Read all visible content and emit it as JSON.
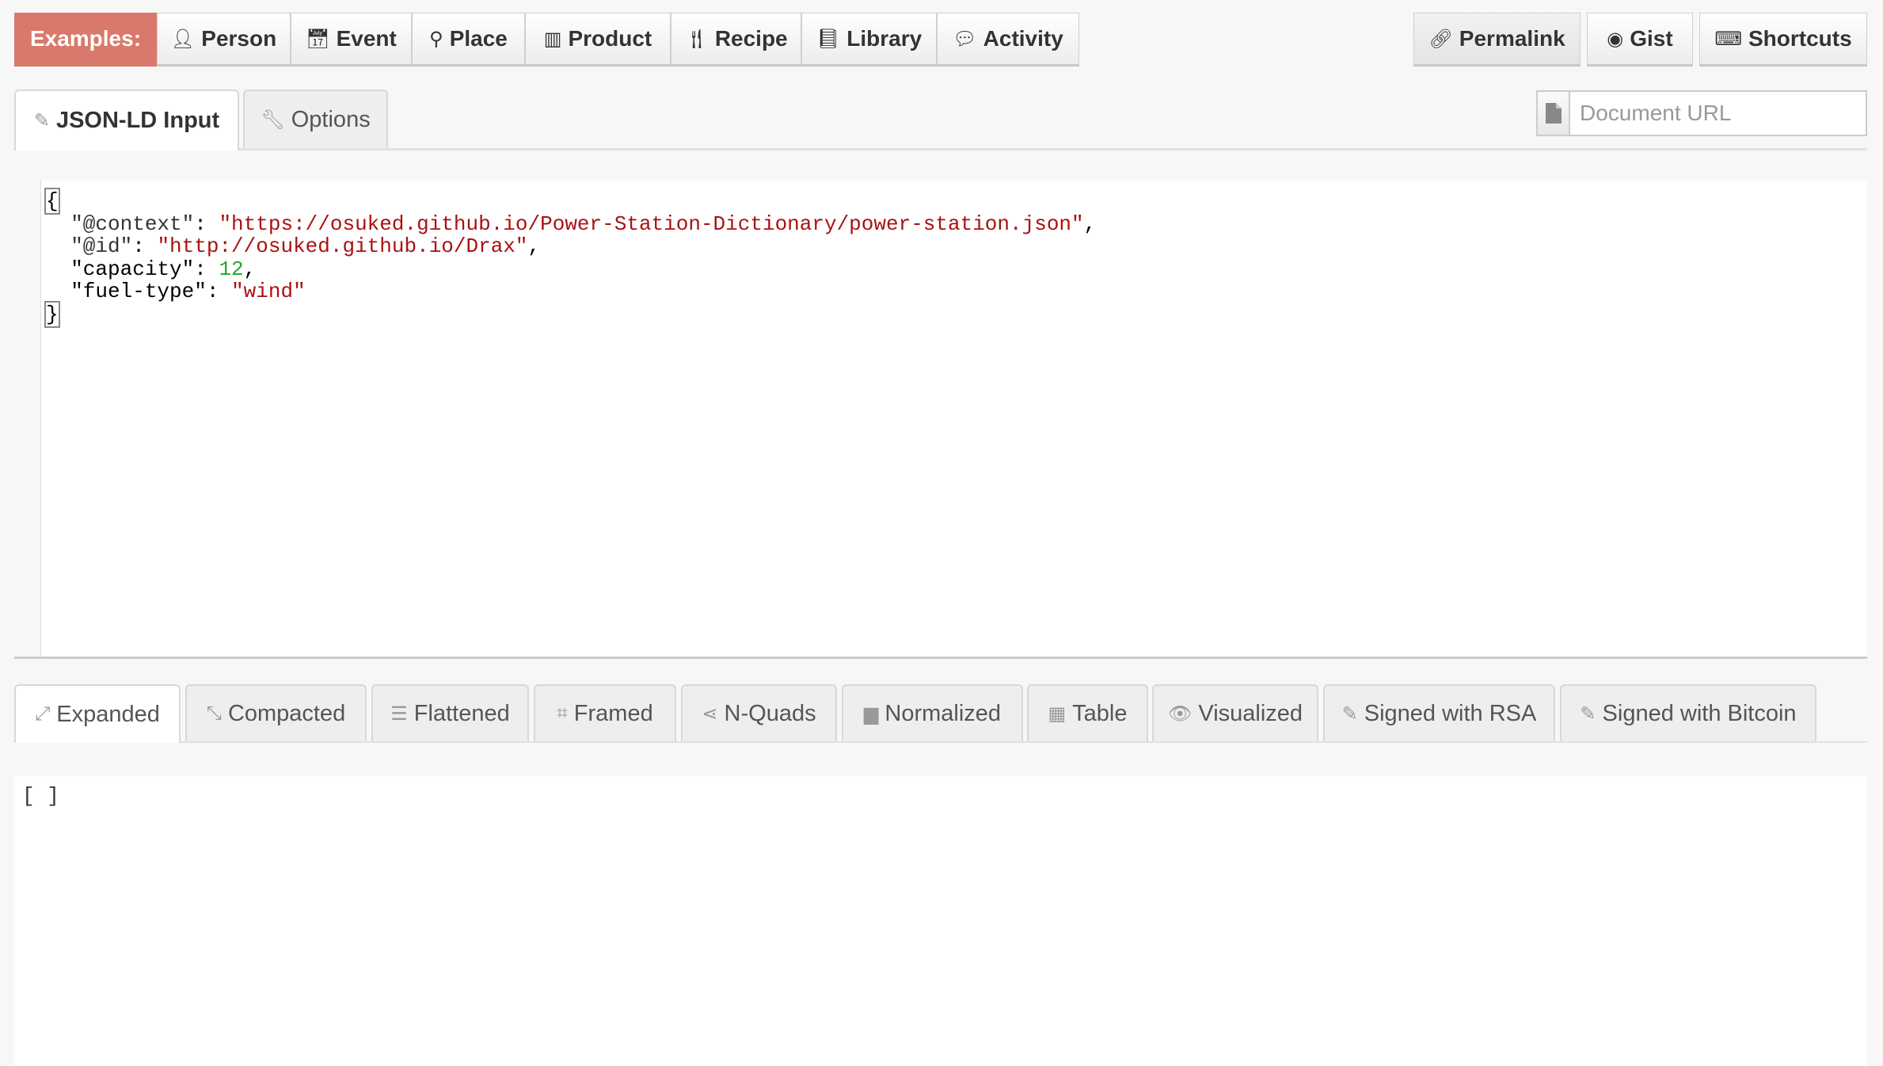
{
  "examples": {
    "label": "Examples:",
    "items": [
      {
        "label": "Person",
        "icon": "user-icon"
      },
      {
        "label": "Event",
        "icon": "calendar-icon"
      },
      {
        "label": "Place",
        "icon": "map-marker-icon"
      },
      {
        "label": "Product",
        "icon": "barcode-icon"
      },
      {
        "label": "Recipe",
        "icon": "cutlery-icon"
      },
      {
        "label": "Library",
        "icon": "book-icon"
      },
      {
        "label": "Activity",
        "icon": "comment-icon"
      }
    ]
  },
  "toolbar": {
    "permalink": "Permalink",
    "gist": "Gist",
    "shortcuts": "Shortcuts"
  },
  "input_tabs": [
    {
      "label": "JSON-LD Input",
      "icon": "pencil-icon"
    },
    {
      "label": "Options",
      "icon": "wrench-icon"
    }
  ],
  "document_url": {
    "placeholder": "Document URL",
    "value": "",
    "icon": "file-icon"
  },
  "editor": {
    "lines": [
      [
        {
          "t": "{",
          "c": "p br"
        }
      ],
      [
        {
          "t": "  \"@context\"",
          "c": "k"
        },
        {
          "t": ": ",
          "c": "p"
        },
        {
          "t": "\"https://osuked.github.io/Power-Station-Dictionary/power-station.json\"",
          "c": "s"
        },
        {
          "t": ",",
          "c": "p"
        }
      ],
      [
        {
          "t": "  \"@id\"",
          "c": "k"
        },
        {
          "t": ": ",
          "c": "p"
        },
        {
          "t": "\"http://osuked.github.io/Drax\"",
          "c": "s"
        },
        {
          "t": ",",
          "c": "p"
        }
      ],
      [
        {
          "t": "  \"capacity\"",
          "c": "p"
        },
        {
          "t": ": ",
          "c": "p"
        },
        {
          "t": "12",
          "c": "n"
        },
        {
          "t": ",",
          "c": "p"
        }
      ],
      [
        {
          "t": "  \"fuel-type\"",
          "c": "p"
        },
        {
          "t": ": ",
          "c": "p"
        },
        {
          "t": "\"wind\"",
          "c": "s"
        }
      ],
      [
        {
          "t": "}",
          "c": "p br"
        }
      ]
    ]
  },
  "output_tabs": [
    {
      "label": "Expanded",
      "icon": "expand-icon",
      "active": true
    },
    {
      "label": "Compacted",
      "icon": "compress-icon"
    },
    {
      "label": "Flattened",
      "icon": "bars-icon"
    },
    {
      "label": "Framed",
      "icon": "crop-icon"
    },
    {
      "label": "N-Quads",
      "icon": "share-nodes-icon"
    },
    {
      "label": "Normalized",
      "icon": "archive-icon"
    },
    {
      "label": "Table",
      "icon": "grid-icon"
    },
    {
      "label": "Visualized",
      "icon": "eye-icon"
    },
    {
      "label": "Signed with RSA",
      "icon": "pencil-icon"
    },
    {
      "label": "Signed with Bitcoin",
      "icon": "pencil-icon"
    }
  ],
  "output": {
    "text": "[ ]"
  }
}
